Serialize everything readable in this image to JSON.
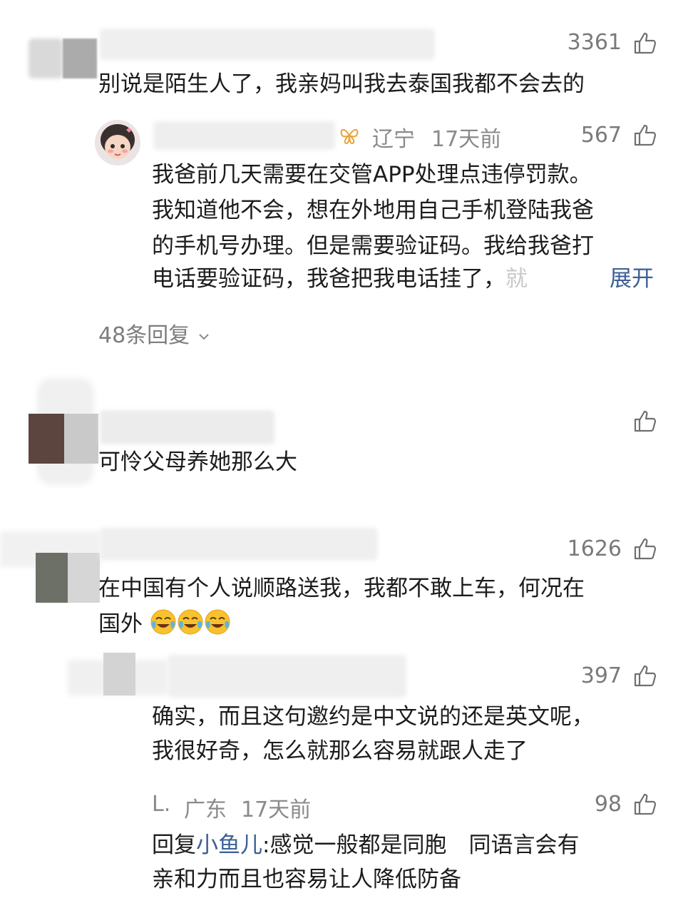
{
  "comments": [
    {
      "text": "别说是陌生人了，我亲妈叫我去泰国我都不会去的",
      "likes": "3361",
      "replies": [
        {
          "location": "辽宁",
          "time": "17天前",
          "likes": "567",
          "lines": [
            "我爸前几天需要在交管APP处理点违停罚款。",
            "我知道他不会，想在外地用自己手机登陆我爸",
            "的手机号办理。但是需要验证码。我给我爸打",
            "电话要验证码，我爸把我电话挂了，"
          ],
          "faded_tail": "就",
          "expand_label": "展开"
        }
      ],
      "reply_count_label": "48条回复"
    },
    {
      "text": "可怜父母养她那么大",
      "likes": ""
    },
    {
      "text_line1": "在中国有个人说顺路送我，我都不敢上车，何况在",
      "text_line2": "国外",
      "likes": "1626",
      "replies": [
        {
          "likes": "397",
          "lines": [
            "确实，而且这句邀约是中文说的还是英文呢，",
            "我很好奇，怎么就那么容易就跟人走了"
          ]
        },
        {
          "author": "L.",
          "location": "广东",
          "time": "17天前",
          "likes": "98",
          "reply_prefix": "回复",
          "reply_to": "小鱼儿",
          "line1_rest": ":感觉一般都是同胞　同语言会有",
          "line2": "亲和力而且也容易让人降低防备"
        }
      ]
    }
  ],
  "icons": {
    "like": "thumbs-up-icon",
    "chevron": "chevron-down-icon",
    "emoji": "crying-laughing-emoji-icon",
    "badge": "butterfly-badge-icon"
  },
  "colors": {
    "link": "#3b5f94",
    "meta": "#8a8a8a",
    "text": "#1c1c1c",
    "badge": "#e8a33a"
  }
}
